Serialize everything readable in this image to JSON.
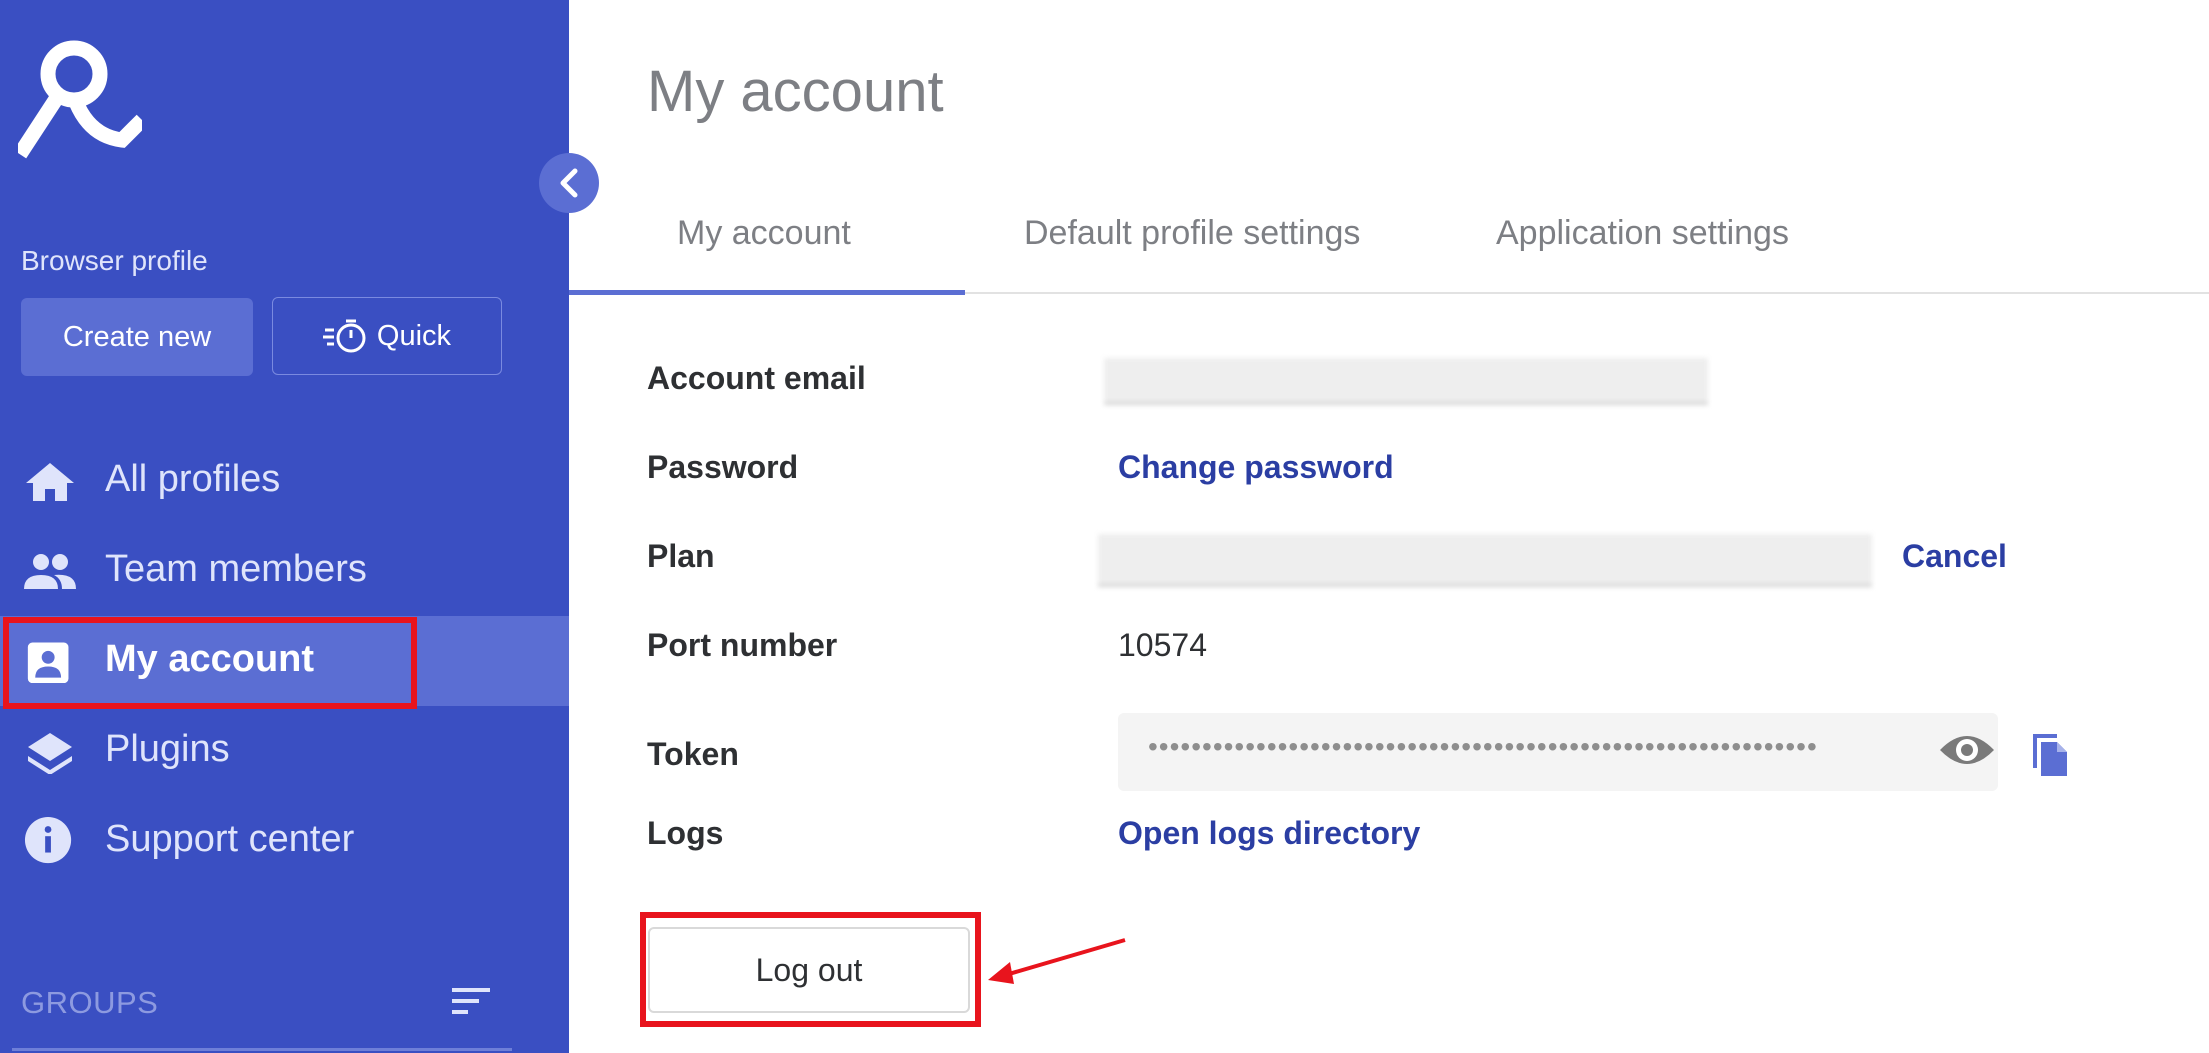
{
  "sidebar": {
    "section_label": "Browser profile",
    "create_label": "Create new",
    "quick_label": "Quick",
    "nav": [
      {
        "label": "All profiles",
        "icon": "home-icon"
      },
      {
        "label": "Team members",
        "icon": "people-icon"
      },
      {
        "label": "My account",
        "icon": "account-box-icon",
        "active": true
      },
      {
        "label": "Plugins",
        "icon": "layers-icon"
      },
      {
        "label": "Support center",
        "icon": "info-icon"
      }
    ],
    "groups_label": "GROUPS"
  },
  "main": {
    "title": "My account",
    "tabs": [
      {
        "label": "My account",
        "active": true
      },
      {
        "label": "Default profile settings"
      },
      {
        "label": "Application settings"
      }
    ],
    "fields": {
      "email_label": "Account email",
      "password_label": "Password",
      "password_action": "Change password",
      "plan_label": "Plan",
      "plan_action": "Cancel",
      "port_label": "Port number",
      "port_value": "10574",
      "token_label": "Token",
      "token_masked": "••••••••••••••••••••••••••••••••••••••••••••••••••••••••••••••",
      "logs_label": "Logs",
      "logs_action": "Open logs directory"
    },
    "logout_label": "Log out"
  },
  "colors": {
    "sidebar_bg": "#3a4fc2",
    "sidebar_active": "#5b6ed3",
    "link": "#2b3ea3",
    "annotation": "#e8141d"
  }
}
